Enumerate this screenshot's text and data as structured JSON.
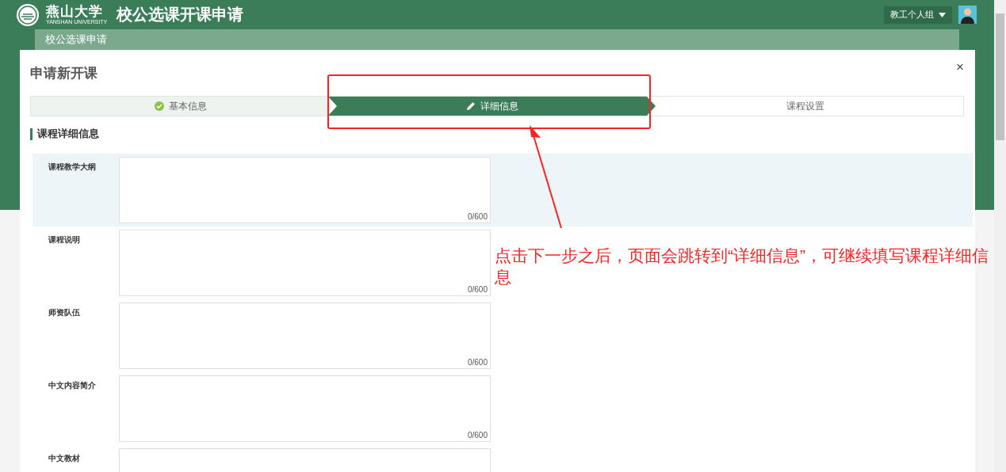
{
  "header": {
    "logo_cn": "燕山大学",
    "logo_en": "YANSHAN UNIVERSITY",
    "title": "校公选课开课申请",
    "user_menu": "教工个人组"
  },
  "breadcrumb": "校公选课申请",
  "dialog": {
    "title": "申请新开课",
    "close": "×",
    "steps": [
      {
        "label": "基本信息",
        "done": true,
        "selected": false
      },
      {
        "label": "详细信息",
        "done": false,
        "selected": true
      },
      {
        "label": "课程设置",
        "done": false,
        "selected": false
      }
    ],
    "section_title": "课程详细信息",
    "fields": [
      {
        "label": "课程教学大纲",
        "counter": "0/600",
        "highlighted": true
      },
      {
        "label": "课程说明",
        "counter": "0/600",
        "highlighted": false
      },
      {
        "label": "师资队伍",
        "counter": "0/600",
        "highlighted": false
      },
      {
        "label": "中文内容简介",
        "counter": "0/600",
        "highlighted": false
      },
      {
        "label": "中文教材",
        "highlighted": false
      }
    ]
  },
  "annotation": {
    "text": "点击下一步之后，页面会跳转到“详细信息”，可继续填写课程详细信息"
  }
}
